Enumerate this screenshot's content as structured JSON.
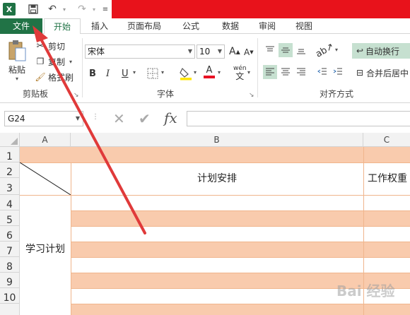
{
  "qat": {
    "logo": "X",
    "save_icon": "save-icon",
    "undo_icon": "undo-icon",
    "redo_icon": "redo-icon"
  },
  "tabs": {
    "file": "文件",
    "home": "开始",
    "insert": "插入",
    "page_layout": "页面布局",
    "formulas": "公式",
    "data": "数据",
    "review": "审阅",
    "view": "视图"
  },
  "ribbon": {
    "clipboard": {
      "paste": "粘贴",
      "cut": "剪切",
      "copy": "复制",
      "format_painter": "格式刷",
      "label": "剪贴板"
    },
    "font": {
      "name": "宋体",
      "size": "10",
      "grow": "A",
      "shrink": "A",
      "bold": "B",
      "italic": "I",
      "underline": "U",
      "phonetic": "wén",
      "label": "字体"
    },
    "alignment": {
      "wrap_text": "自动换行",
      "merge_center": "合并后居中",
      "label": "对齐方式"
    }
  },
  "formula_bar": {
    "name_box": "G24",
    "fx": "fx",
    "value": ""
  },
  "sheet": {
    "columns": [
      "A",
      "B",
      "C"
    ],
    "rows": [
      "1",
      "2",
      "3",
      "4",
      "5",
      "6",
      "7",
      "8",
      "9",
      "10"
    ],
    "cells": {
      "B2": "计划安排",
      "C2": "工作权重",
      "A4": "学习计划"
    },
    "stripe_color": "#f9cbad"
  },
  "annotation": {
    "arrow_color": "#e03a3a"
  },
  "watermark": "Bai 经验"
}
